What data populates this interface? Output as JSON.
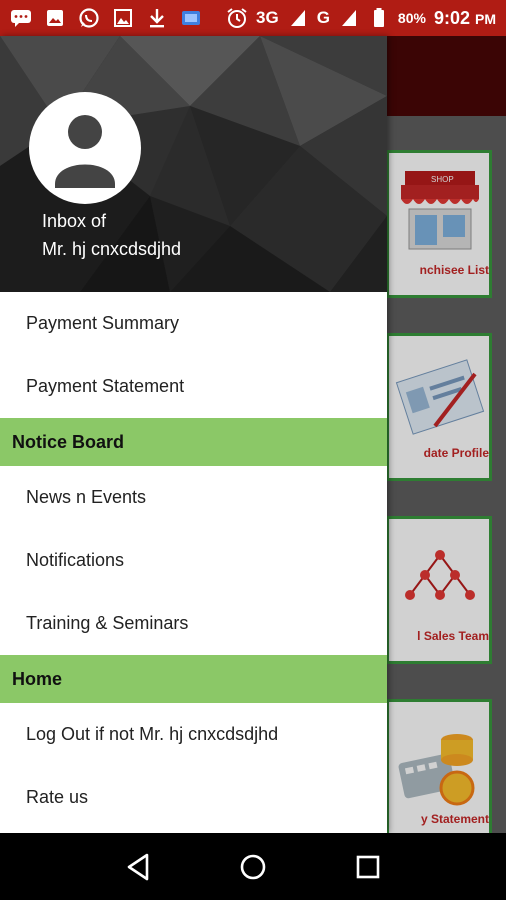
{
  "status_bar": {
    "network": "3G",
    "network2": "G",
    "battery": "80%",
    "time": "9:02",
    "ampm": "PM",
    "left_icons": [
      "message-icon",
      "image-icon",
      "whatsapp-icon",
      "gallery-icon",
      "download-icon",
      "cast-icon"
    ]
  },
  "drawer": {
    "inbox_label": "Inbox of",
    "user_name": "Mr. hj cnxcdsdjhd",
    "items": [
      {
        "type": "item",
        "label": "Payment Summary"
      },
      {
        "type": "item",
        "label": "Payment Statement"
      },
      {
        "type": "section",
        "label": "Notice Board"
      },
      {
        "type": "item",
        "label": "News n Events"
      },
      {
        "type": "item",
        "label": "Notifications"
      },
      {
        "type": "item",
        "label": "Training & Seminars"
      },
      {
        "type": "section",
        "label": "Home"
      },
      {
        "type": "item",
        "label": "Log Out if not Mr. hj cnxcdsdjhd"
      },
      {
        "type": "item",
        "label": "Rate us"
      }
    ]
  },
  "background_tiles": [
    {
      "label": "nchisee List",
      "icon": "shop-icon"
    },
    {
      "label": "date Profile",
      "icon": "profile-card-icon"
    },
    {
      "label": "l Sales Team",
      "icon": "network-icon"
    },
    {
      "label": "y Statement",
      "icon": "coins-calculator-icon"
    }
  ],
  "colors": {
    "status_bar": "#b01c14",
    "section_header": "#8bc867",
    "tile_border": "#2e7d32",
    "tile_label": "#c62828"
  },
  "nav": {
    "back": "back-icon",
    "home": "home-icon",
    "recents": "recents-icon"
  }
}
